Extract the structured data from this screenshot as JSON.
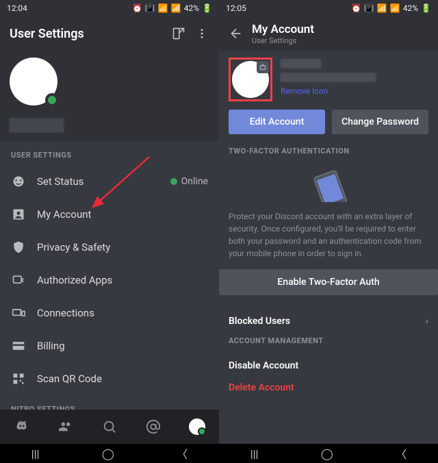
{
  "left": {
    "time": "12:04",
    "battery": "42%",
    "header_title": "User Settings",
    "section_user_settings": "USER SETTINGS",
    "section_nitro": "NITRO SETTINGS",
    "online_label": "Online",
    "menu": {
      "set_status": "Set Status",
      "my_account": "My Account",
      "privacy": "Privacy & Safety",
      "authorized": "Authorized Apps",
      "connections": "Connections",
      "billing": "Billing",
      "scan_qr": "Scan QR Code"
    }
  },
  "right": {
    "time": "12:05",
    "battery": "42%",
    "header_title": "My Account",
    "header_sub": "User Settings",
    "remove_icon": "Remove Icon",
    "edit_account": "Edit Account",
    "change_password": "Change Password",
    "twofa_title": "TWO-FACTOR AUTHENTICATION",
    "twofa_desc": "Protect your Discord account with an extra layer of security. Once configured, you'll be required to enter both your password and an authentication code from your mobile phone in order to sign in.",
    "enable_2fa": "Enable Two-Factor Auth",
    "blocked_users": "Blocked Users",
    "account_mgmt": "ACCOUNT MANAGEMENT",
    "disable_account": "Disable Account",
    "delete_account": "Delete Account"
  }
}
